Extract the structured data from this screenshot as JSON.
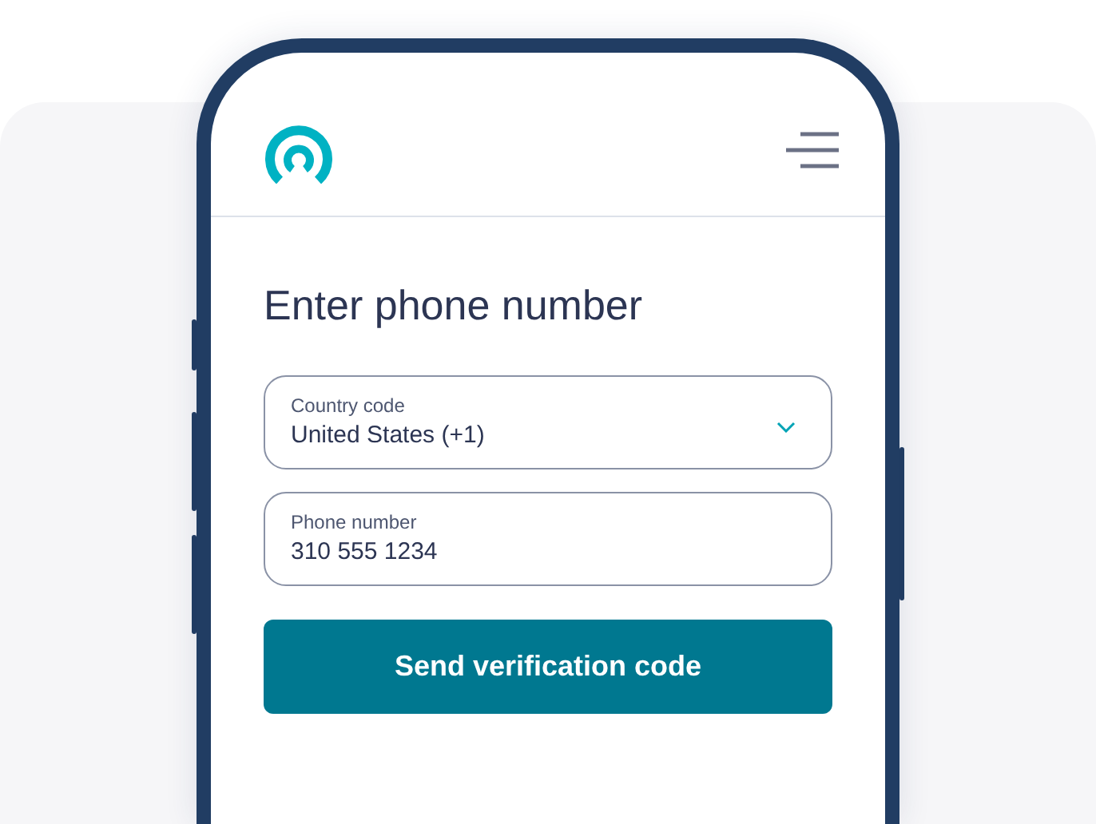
{
  "form": {
    "title": "Enter phone number",
    "fields": [
      {
        "kind": "select",
        "label": "Country code",
        "value": "United States (+1)"
      },
      {
        "kind": "text",
        "label": "Phone number",
        "value": "310 555 1234"
      }
    ],
    "button": "Send verification code"
  }
}
